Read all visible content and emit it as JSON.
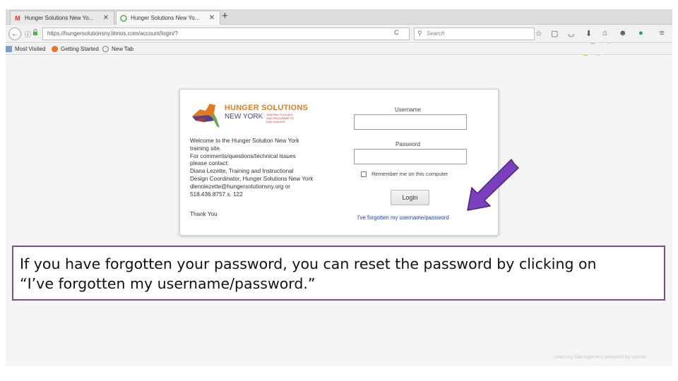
{
  "browser": {
    "tabs": [
      {
        "label": "Hunger Solutions New Yo...",
        "favicon": "gmail-icon"
      },
      {
        "label": "Hunger Solutions New Yo...",
        "favicon": "site-icon"
      }
    ],
    "new_tab_glyph": "+",
    "tab_close_glyph": "✕",
    "url": "https://hungersolutionsny.litmos.com/account/login/?",
    "search_placeholder": "Search",
    "bookmarks": [
      "Most Visited",
      "Getting Started",
      "New Tab"
    ]
  },
  "login": {
    "logo_title": "HUNGER SOLUTIONS",
    "logo_subtitle": "NEW YORK",
    "logo_tagline": "SHAPING POLICIES AND PROGRAMS TO END HUNGER",
    "welcome_lines": [
      "Welcome to the Hunger Solution New York",
      "training site.",
      "For comments/questions/technical issues",
      "please contact:",
      "Diana Lezette, Training and Instructional",
      "Design Coordinator, Hunger Solutions New York",
      "dlenolezette@hungersolutionsny.org or",
      "518.436.8757 x. 122"
    ],
    "thanks": "Thank You",
    "username_label": "Username",
    "password_label": "Password",
    "remember_label": "Remember me on this computer",
    "login_button": "Login",
    "forgot_link": "I've forgotten my username/password"
  },
  "callout": {
    "lines": [
      "If you have forgotten your password, you can reset the password by clicking on",
      "“I’ve forgotten my username/password.”"
    ]
  },
  "footer": "Learning Management powered by Litmos",
  "colors": {
    "arrow": "#7d3fbe",
    "callout_border": "#7a4b96",
    "link": "#1a3fb0",
    "logo_orange": "#e07b1f",
    "logo_purple": "#5a3d86"
  }
}
